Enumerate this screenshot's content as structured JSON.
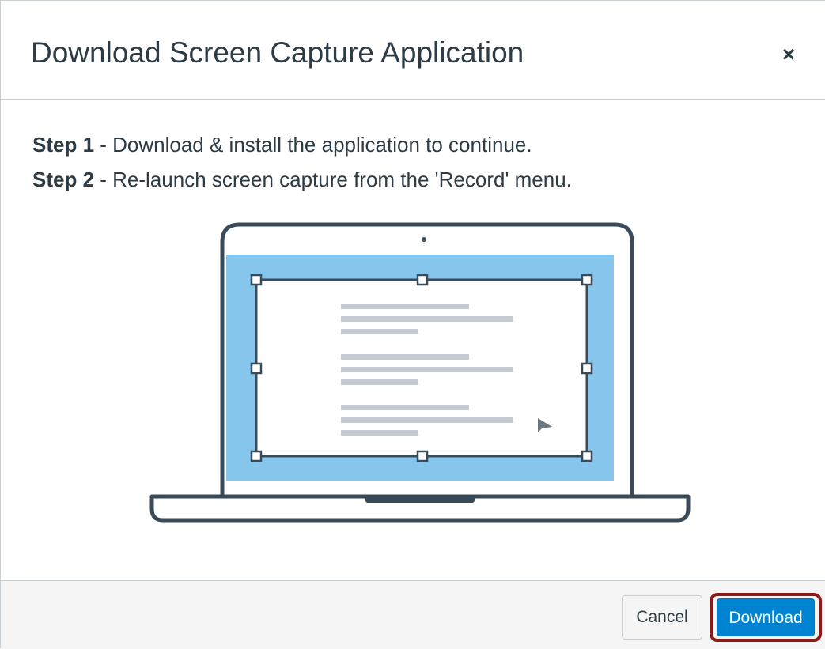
{
  "dialog": {
    "title": "Download Screen Capture Application",
    "close_label": "×"
  },
  "steps": [
    {
      "label": "Step 1",
      "text": " - Download & install the application to continue."
    },
    {
      "label": "Step 2",
      "text": " - Re-launch screen capture from the 'Record' menu."
    }
  ],
  "footer": {
    "cancel_label": "Cancel",
    "download_label": "Download"
  },
  "colors": {
    "primary": "#0084d1",
    "highlight_outline": "#8b1a1a",
    "screen_blue": "#86c5ec",
    "device_stroke": "#394b58",
    "text": "#2d3b45"
  },
  "icons": [
    "close-icon",
    "laptop-illustration",
    "cursor-icon"
  ]
}
